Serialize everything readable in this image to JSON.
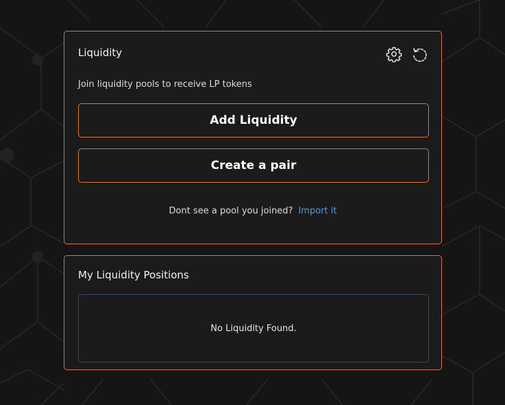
{
  "liquidity": {
    "title": "Liquidity",
    "subtitle": "Join liquidity pools to receive LP tokens",
    "add_button": "Add Liquidity",
    "create_button": "Create a pair",
    "footer_text": "Dont see a pool you joined?",
    "import_link": "Import it",
    "icons": [
      "gear-icon",
      "history-icon"
    ]
  },
  "positions": {
    "title": "My Liquidity Positions",
    "empty_text": "No Liquidity Found."
  },
  "colors": {
    "accent_border": "#d9772f",
    "link": "#4a9ee8",
    "card_bg": "#1b1b1b",
    "page_bg": "#151515"
  }
}
